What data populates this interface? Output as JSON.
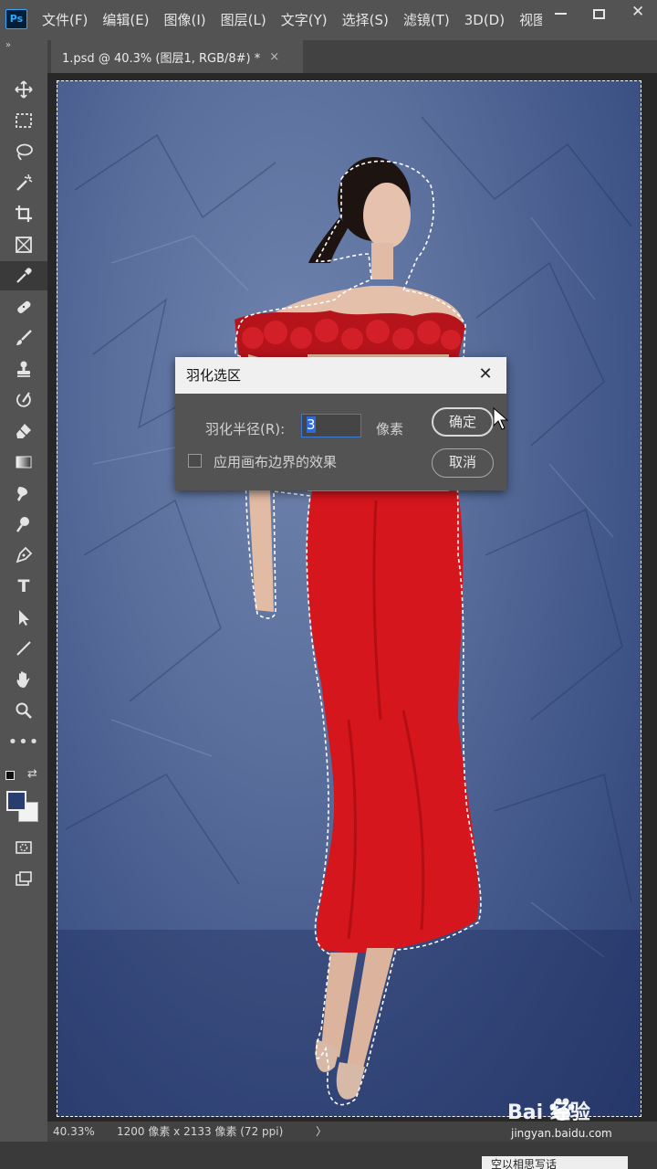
{
  "app": {
    "logo": "Ps"
  },
  "menu": [
    "文件(F)",
    "编辑(E)",
    "图像(I)",
    "图层(L)",
    "文字(Y)",
    "选择(S)",
    "滤镜(T)",
    "3D(D)",
    "视图"
  ],
  "window_controls": {
    "close_glyph": "✕"
  },
  "document_tab": {
    "title": "1.psd @ 40.3% (图层1, RGB/8#) *",
    "close_glyph": "×"
  },
  "toolbar": {
    "collapse_glyph": "»",
    "tools": [
      "move-tool",
      "marquee-tool",
      "lasso-tool",
      "magic-wand-tool",
      "crop-tool",
      "frame-tool",
      "eyedropper-tool",
      "healing-tool",
      "brush-tool",
      "stamp-tool",
      "history-brush-tool",
      "eraser-tool",
      "gradient-tool",
      "blur-tool",
      "dodge-tool",
      "pen-tool",
      "type-tool",
      "path-select-tool",
      "line-tool",
      "hand-tool",
      "zoom-tool",
      "more-tools"
    ],
    "active_tool": "eyedropper-tool",
    "type_tool_glyph": "T",
    "more_glyph": "•••",
    "foreground_color": "#2a3d6f",
    "background_color": "#f2f2f2"
  },
  "dialog": {
    "title": "羽化选区",
    "close_glyph": "✕",
    "radius_label": "羽化半径(R):",
    "radius_value": "3",
    "radius_unit": "像素",
    "ok_button": "确定",
    "cancel_button": "取消",
    "checkbox_label": "应用画布边界的效果",
    "checkbox_checked": false
  },
  "status": {
    "zoom": "40.33%",
    "doc_info": "1200 像素 x 2133 像素 (72 ppi)",
    "arrow": "〉"
  },
  "watermark": {
    "brand": "Bai  经验",
    "url": "jingyan.baidu.com"
  },
  "notification": {
    "text": "空以相思写话"
  }
}
